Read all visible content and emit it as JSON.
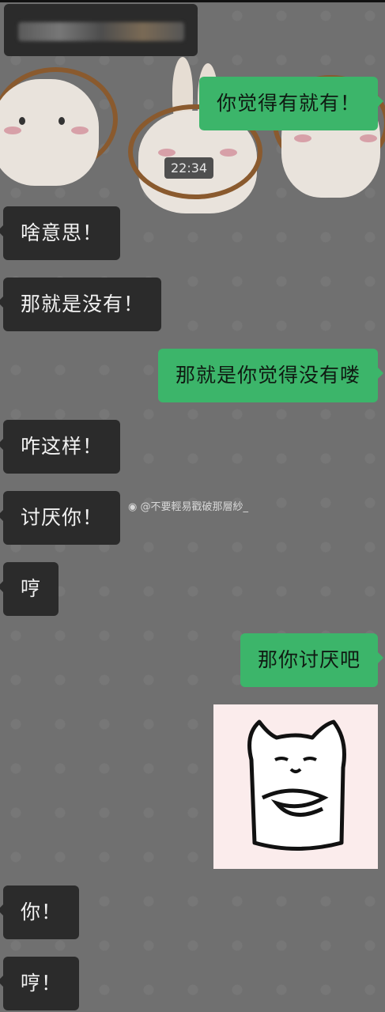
{
  "time_divider": "22:34",
  "watermark": "@不要輕易戳破那層紗_",
  "messages": [
    {
      "side": "out",
      "text": "你觉得有就有！"
    },
    {
      "side": "in",
      "text": "啥意思！"
    },
    {
      "side": "in",
      "text": "那就是没有！"
    },
    {
      "side": "out",
      "text": "那就是你觉得没有喽"
    },
    {
      "side": "in",
      "text": "咋这样！"
    },
    {
      "side": "in",
      "text": "讨厌你！"
    },
    {
      "side": "in",
      "text": "哼"
    },
    {
      "side": "out",
      "text": "那你讨厌吧"
    },
    {
      "side": "in",
      "text": "你！"
    },
    {
      "side": "in",
      "text": "哼！"
    }
  ],
  "colors": {
    "incoming_bubble": "#2b2b2b",
    "outgoing_bubble": "#3cb56a",
    "background": "#707070"
  },
  "icons": {
    "watermark": "weibo-icon",
    "sticker": "cat-sticker"
  }
}
